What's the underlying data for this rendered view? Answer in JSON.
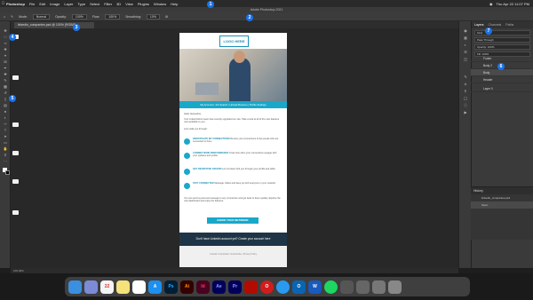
{
  "menubar": {
    "app_name": "Photoshop",
    "items": [
      "File",
      "Edit",
      "Image",
      "Layer",
      "Type",
      "Select",
      "Filter",
      "3D",
      "View",
      "Plugins",
      "Window",
      "Help"
    ],
    "clock": "Thu Apr 22  11:07 PM"
  },
  "window": {
    "title": "Adobe Photoshop 2021"
  },
  "options": {
    "mode_label": "Mode:",
    "mode_value": "Normal",
    "opacity_label": "Opacity:",
    "opacity_value": "100%",
    "flow_label": "Flow:",
    "flow_value": "100%",
    "smoothing_label": "Smoothing:",
    "smoothing_value": "10%"
  },
  "document": {
    "tab_title": "linkedin_companies.psd @ 100% (RGB/8)",
    "logo_text": "LOGO HERE",
    "nav_text": "My Account  |  Job Search  |  Upload Resume  |  Profile Settings",
    "greeting": "Hello Jacqueline,",
    "intro": "Your Linked Admin team has recently upgraded our site. Take a look at all of the new features now available to you.",
    "features_heading": "Let's walk you through:",
    "features": [
      {
        "title": "INVESTIGATE MY CONNECTIONS",
        "body": "Review your connections & the people who are connected to them."
      },
      {
        "title": "CONNECTIONS PERFORMANCE",
        "body": "Track how often your connections engage with your updates and profile."
      },
      {
        "title": "GET RECRUITED OFFERS",
        "body": "Let recruiters find you through your profile and skills."
      },
      {
        "title": "STAY CONNECTED",
        "body": "Message, follow and keep up with everyone in your network."
      }
    ],
    "closing": "You can send a personal message to any connection and get back to them quickly. Explore the new dashboard and enjoy the features.",
    "cta_label": "GROW YOUR NETWORK",
    "dark_band": "Don't have Linkedin account yet? Create your account here",
    "footer": "Linkedin Corporation\nUnsubscribe | Privacy Policy"
  },
  "status": {
    "zoom": "100.00%"
  },
  "panels": {
    "tabs": [
      "Layers",
      "Channels",
      "Paths"
    ],
    "search_label": "Kind",
    "blend_mode": "Pass Through",
    "opacity": "Opacity: 100%",
    "lock_label": "Lock:",
    "fill": "Fill: 100%",
    "layers": [
      "Footer",
      "Body 2",
      "Body",
      "Header",
      "Layer 0"
    ],
    "history_title": "History",
    "history_items": [
      "linkedin_companies.psd",
      "Open"
    ]
  },
  "dock": {
    "apps": [
      "Finder",
      "Launchpad",
      "Calendar",
      "Notes",
      "App Store",
      "Ps",
      "Ai",
      "Id",
      "Ae",
      "Pr",
      "Acrobat",
      "Opera",
      "Safari",
      "Outlook",
      "Word",
      "Spotify",
      "Screens",
      "Preview",
      "Photos",
      "Trash"
    ]
  },
  "markers": [
    "1",
    "2",
    "3",
    "4",
    "5",
    "6",
    "7"
  ]
}
